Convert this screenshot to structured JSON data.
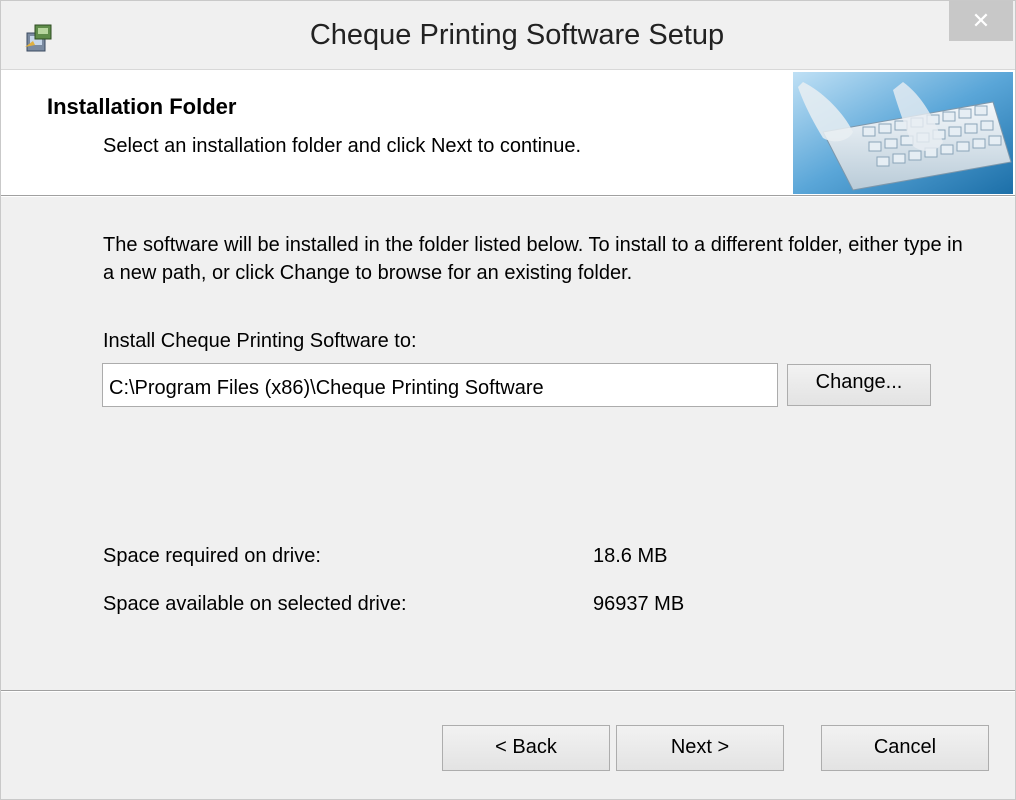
{
  "window": {
    "title": "Cheque Printing Software Setup",
    "close_glyph": "✕",
    "app_icon": "setup-icon"
  },
  "header": {
    "title": "Installation Folder",
    "subtitle": "Select an installation folder and click Next to continue.",
    "image": "keyboard-typing-image"
  },
  "body": {
    "description": "The software will be installed in the folder listed below. To install to a different folder, either type in a new path, or click Change to browse for an existing folder.",
    "install_label": "Install Cheque Printing Software to:",
    "install_path": "C:\\Program Files (x86)\\Cheque Printing Software",
    "change_label": "Change...",
    "space_required_label": "Space required on drive:",
    "space_required_value": "18.6 MB",
    "space_available_label": "Space available on selected drive:",
    "space_available_value": "96937 MB"
  },
  "footer": {
    "back_label": "< Back",
    "next_label": "Next >",
    "cancel_label": "Cancel"
  },
  "colors": {
    "window_bg": "#f0f0f0",
    "header_bg": "#ffffff",
    "close_bg": "#c8c8c8"
  }
}
